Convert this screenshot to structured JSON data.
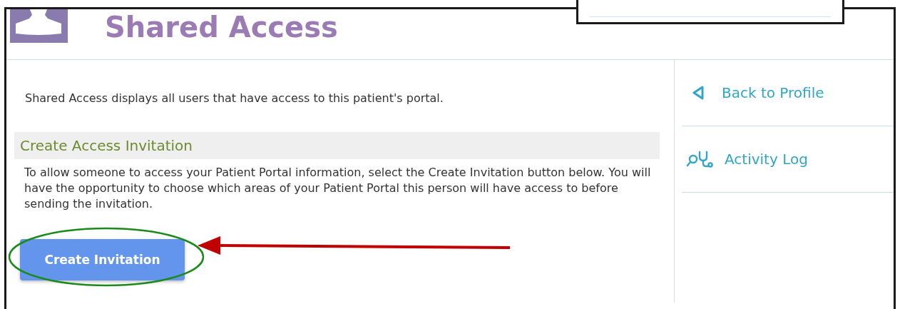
{
  "header": {
    "title": "Shared Access"
  },
  "intro": "Shared Access displays all users that have access to this patient's portal.",
  "invitation_section": {
    "heading": "Create Access Invitation",
    "text": "To allow someone to access your Patient Portal information, select the Create Invitation button below. You will have the opportunity to choose which areas of your Patient Portal this person will have access to before sending the invitation.",
    "button": "Create Invitation"
  },
  "sidebar": {
    "items": [
      {
        "label": "Back to Profile",
        "kind": "back"
      },
      {
        "label": "Activity Log",
        "kind": "log"
      }
    ]
  }
}
